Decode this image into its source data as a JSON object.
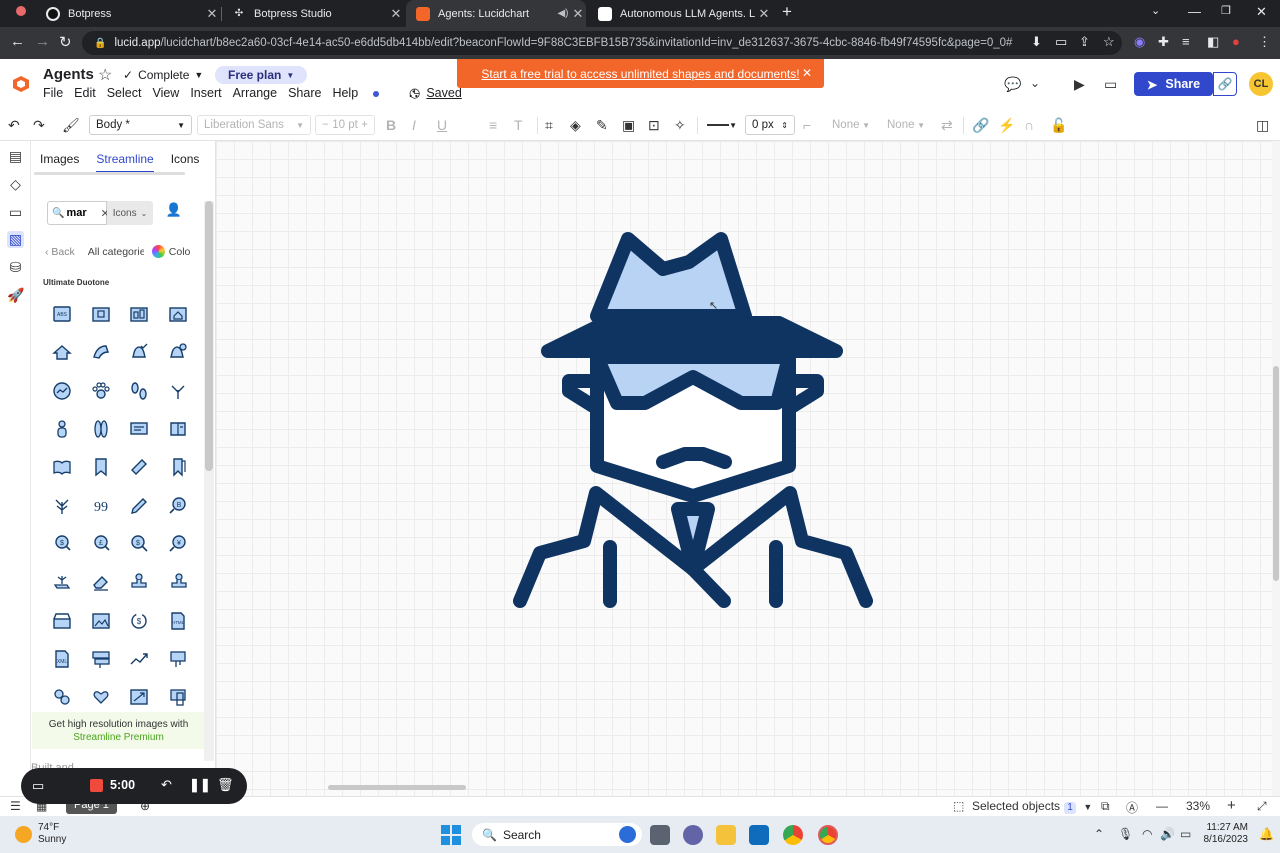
{
  "browser": {
    "tabs": [
      {
        "title": "Botpress",
        "favicon_color": "#e8eaed",
        "active": false
      },
      {
        "title": "Botpress Studio",
        "favicon_color": "#e8eaed",
        "active": false
      },
      {
        "title": "Agents: Lucidchart",
        "favicon_color": "#f2662a",
        "active": true
      },
      {
        "title": "Autonomous LLM Agents. LLM A",
        "favicon_color": "#ffffff",
        "active": false
      }
    ],
    "url_host": "lucid.app",
    "url_path": "/lucidchart/b8ec2a60-03cf-4e14-ac50-e6dd5db414bb/edit?beaconFlowId=9F88C3EBFB15B735&invitationId=inv_de312637-3675-4cbc-8846-fb49f74595fc&page=0_0#"
  },
  "header": {
    "doc_title": "Agents",
    "status": "Complete",
    "plan": "Free plan",
    "menu": [
      "File",
      "Edit",
      "Select",
      "View",
      "Insert",
      "Arrange",
      "Share",
      "Help"
    ],
    "saved": "Saved",
    "banner": "Start a free trial to access unlimited shapes and documents!",
    "share_label": "Share",
    "avatar_initials": "CL",
    "brand_color": "#f2662a",
    "accent_color": "#3147cc"
  },
  "toolbar": {
    "text_style": "Body *",
    "font": "Liberation Sans",
    "font_size": "10 pt",
    "line_width": "0 px",
    "line_start": "None",
    "line_end": "None"
  },
  "panel": {
    "tabs": [
      "Images",
      "Streamline",
      "Icons"
    ],
    "active_tab": "Streamline",
    "search_value": "mar",
    "filter": "Icons",
    "back_label": "Back",
    "all_categories": "All categorie",
    "color_label": "Colo",
    "group_title": "Ultimate Duotone",
    "promo_line1": "Get high resolution images with",
    "promo_line2": "Streamline Premium",
    "faded_text": "Built and"
  },
  "bottom": {
    "page_label": "Page 1",
    "selected_label": "Selected objects",
    "selected_count": "1",
    "zoom": "33%"
  },
  "recorder": {
    "time": "5:00"
  },
  "taskbar": {
    "temp": "74°F",
    "weather": "Sunny",
    "search": "Search",
    "time": "11:27 AM",
    "date": "8/16/2023"
  }
}
